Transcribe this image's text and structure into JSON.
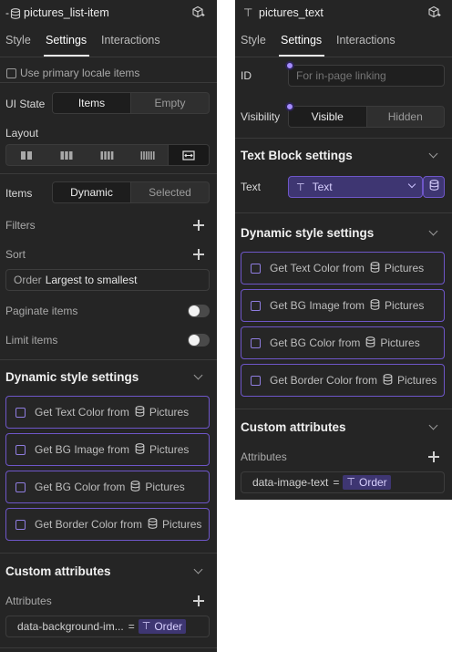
{
  "left": {
    "title_prefix": "-",
    "title": "pictures_list-item",
    "tabs": [
      "Style",
      "Settings",
      "Interactions"
    ],
    "active_tab": "Settings",
    "primary_locale_label": "Use primary locale items",
    "ui_state": {
      "label": "UI State",
      "options": [
        "Items",
        "Empty"
      ],
      "selected": "Items"
    },
    "layout": {
      "label": "Layout",
      "selected_index": 4
    },
    "items": {
      "label": "Items",
      "options": [
        "Dynamic",
        "Selected"
      ],
      "selected": "Dynamic"
    },
    "filters_label": "Filters",
    "sort_label": "Sort",
    "sort_field": {
      "key": "Order",
      "value": "Largest to smallest"
    },
    "paginate_label": "Paginate items",
    "limit_label": "Limit items",
    "dynamic_style": {
      "heading": "Dynamic style settings",
      "source": "Pictures",
      "rows": [
        "Get Text Color from",
        "Get BG Image from",
        "Get BG Color from",
        "Get Border Color from"
      ]
    },
    "custom_attributes": {
      "heading": "Custom attributes",
      "label": "Attributes",
      "attr_name": "data-background-im...",
      "equals": "=",
      "attr_value": "Order"
    }
  },
  "right": {
    "title": "pictures_text",
    "tabs": [
      "Style",
      "Settings",
      "Interactions"
    ],
    "active_tab": "Settings",
    "id": {
      "label": "ID",
      "placeholder": "For in-page linking"
    },
    "visibility": {
      "label": "Visibility",
      "options": [
        "Visible",
        "Hidden"
      ],
      "selected": "Visible"
    },
    "text_block": {
      "heading": "Text Block settings",
      "label": "Text",
      "value": "Text"
    },
    "dynamic_style": {
      "heading": "Dynamic style settings",
      "source": "Pictures",
      "rows": [
        "Get Text Color from",
        "Get BG Image from",
        "Get BG Color from",
        "Get Border Color from"
      ]
    },
    "custom_attributes": {
      "heading": "Custom attributes",
      "label": "Attributes",
      "attr_name": "data-image-text",
      "equals": "=",
      "attr_value": "Order"
    }
  },
  "colors": {
    "panel_bg": "#252525",
    "accent_purple": "#6e56c8",
    "tag_bg": "#3e3672"
  }
}
